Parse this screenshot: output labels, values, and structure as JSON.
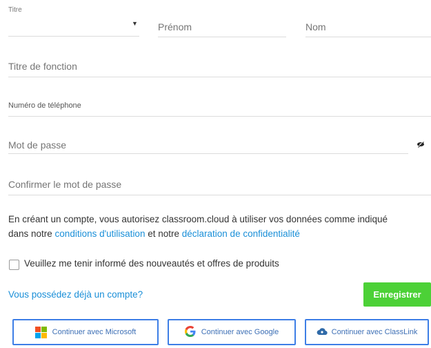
{
  "form": {
    "title_label": "Titre",
    "title_arrow": "▼",
    "first_name_placeholder": "Prénom",
    "last_name_placeholder": "Nom",
    "job_title_placeholder": "Titre de fonction",
    "phone_label": "Numéro de téléphone",
    "password_placeholder": "Mot de passe",
    "confirm_password_placeholder": "Confirmer le mot de passe"
  },
  "terms": {
    "line1": "En créant un compte, vous autorisez classroom.cloud à utiliser vos données comme indiqué",
    "prefix2": "dans notre ",
    "terms_link": "conditions d'utilisation",
    "middle": " et notre ",
    "privacy_link": "déclaration de confidentialité"
  },
  "newsletter": {
    "label": "Veuillez me tenir informé des nouveautés et offres de produits"
  },
  "account": {
    "login_link": "Vous possédez déjà un compte?",
    "register_button": "Enregistrer"
  },
  "sso": {
    "microsoft": "Continuer avec Microsoft",
    "google": "Continuer avec Google",
    "classlink": "Continuer avec ClassLink"
  },
  "colors": {
    "accent_green": "#4cd137",
    "link_blue": "#1a8fd8",
    "sso_border": "#3d7ee6"
  },
  "icons": {
    "eye": "eye-slash-icon",
    "microsoft": "microsoft-logo-icon",
    "google": "google-logo-icon",
    "classlink": "classlink-cloud-icon"
  }
}
